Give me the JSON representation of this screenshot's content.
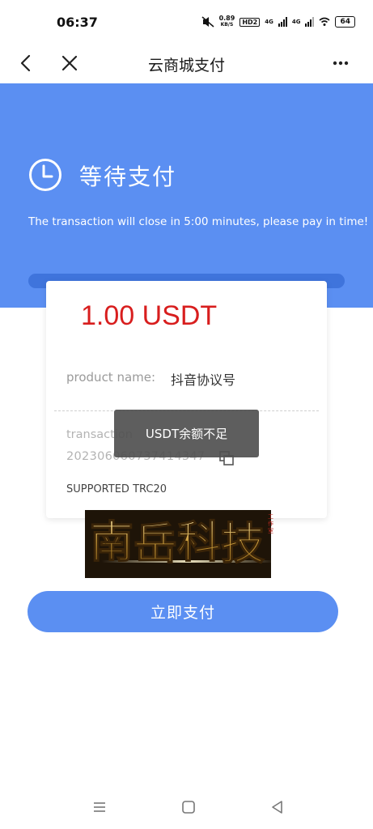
{
  "status_bar": {
    "time": "06:37",
    "net_speed_value": "0.89",
    "net_speed_unit": "KB/S",
    "hd_label": "HD2",
    "signal1_label": "4G",
    "signal2_label": "4G",
    "battery": "64"
  },
  "nav": {
    "title": "云商城支付",
    "back_icon": "chevron-left-icon",
    "close_icon": "close-icon",
    "more_icon": "more-dots-icon"
  },
  "banner": {
    "title": "等待支付",
    "subtitle": "The transaction will close in 5:00  minutes, please pay in time!",
    "color": "#5b8ff2"
  },
  "card": {
    "amount": "1.00 USDT",
    "product_label": "product name:",
    "product_value": "抖音协议号",
    "transaction_label": "transaction",
    "transaction_value": "2023060607374143​47",
    "supported": "SUPPORTED TRC20"
  },
  "toast": {
    "message": "USDT余额不足"
  },
  "logo": {
    "text": "南岳科技",
    "stamp": "工作室"
  },
  "pay_button": {
    "label": "立即支付"
  },
  "colors": {
    "accent": "#5b8ff2",
    "amount_red": "#d81e1e"
  }
}
